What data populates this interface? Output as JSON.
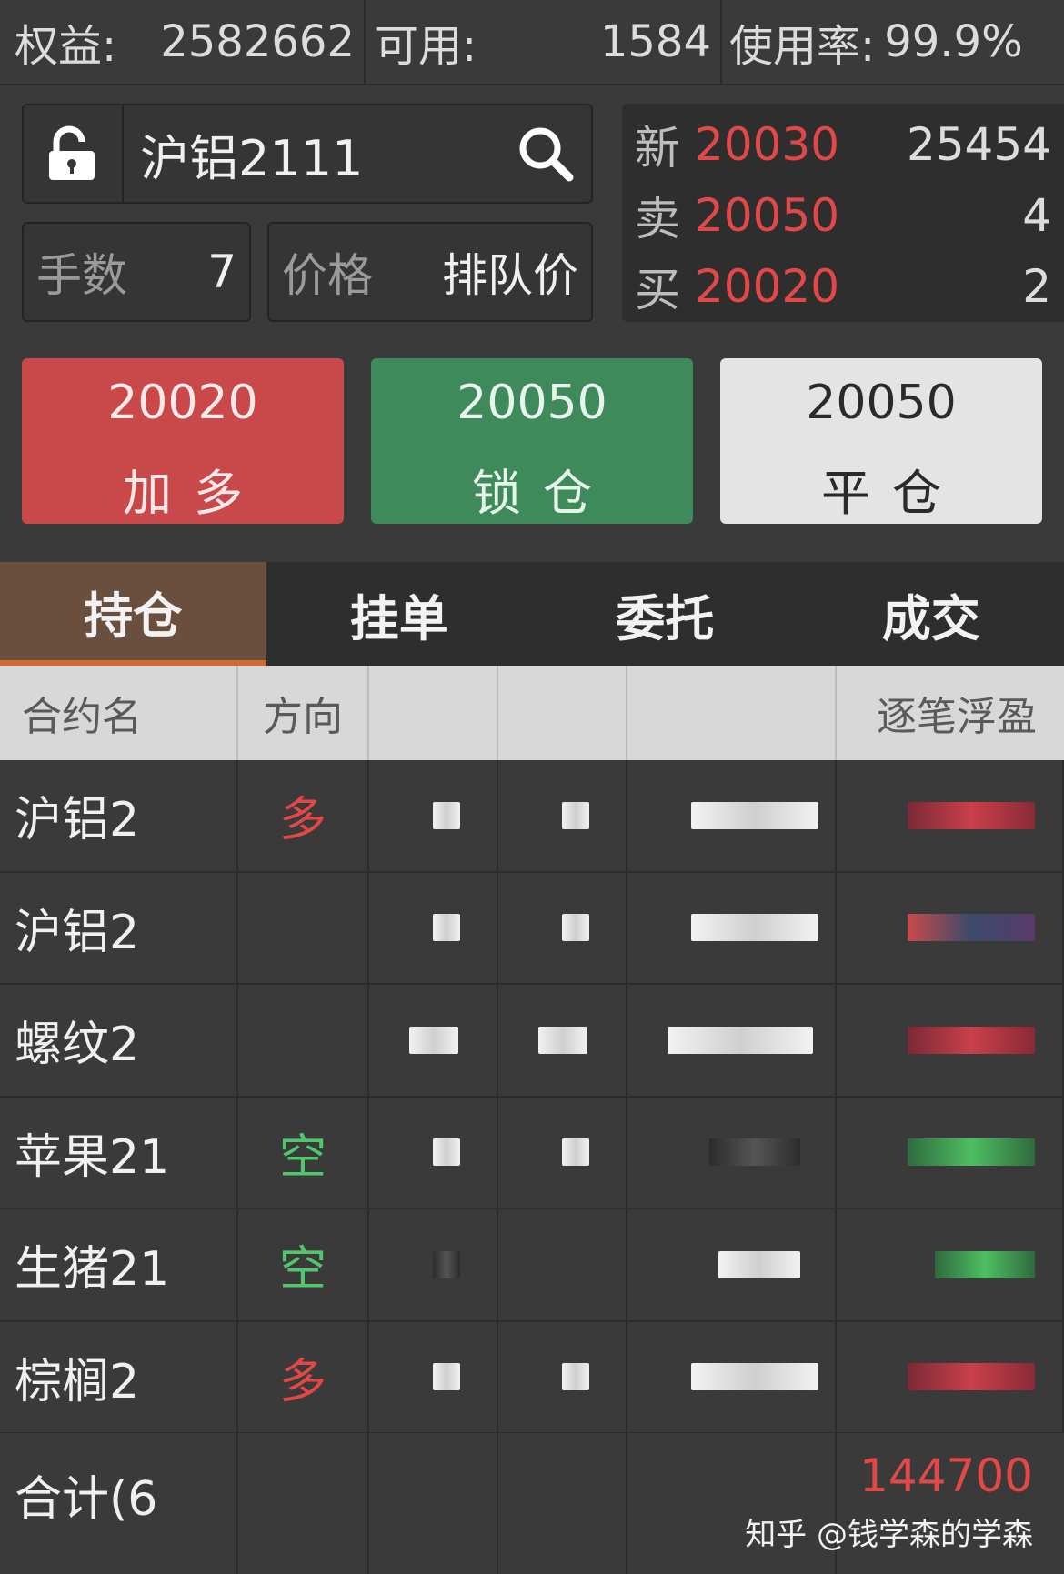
{
  "account": {
    "equity_label": "权益:",
    "equity_value": "2582662",
    "available_label": "可用:",
    "available_value": "1584",
    "usage_label": "使用率:",
    "usage_value": "99.9%"
  },
  "order": {
    "symbol": "沪铝2111",
    "lots_label": "手数",
    "lots_value": "7",
    "price_label": "价格",
    "price_value": "排队价"
  },
  "quote": {
    "last_label": "新",
    "last_price": "20030",
    "last_volume": "25454",
    "ask_label": "卖",
    "ask_price": "20050",
    "ask_volume": "4",
    "bid_label": "买",
    "bid_price": "20020",
    "bid_volume": "2"
  },
  "actions": {
    "buy_price": "20020",
    "buy_label": "加多",
    "lock_price": "20050",
    "lock_label": "锁仓",
    "close_price": "20050",
    "close_label": "平仓"
  },
  "tabs": [
    "持仓",
    "挂单",
    "委托",
    "成交"
  ],
  "table": {
    "headers": {
      "name": "合约名",
      "direction": "方向",
      "pnl": "逐笔浮盈"
    },
    "rows": [
      {
        "name": "沪铝2",
        "direction": "多",
        "dir_class": "long",
        "pnl_class": "red"
      },
      {
        "name": "沪铝2",
        "direction": "",
        "dir_class": "long",
        "pnl_class": "mix"
      },
      {
        "name": "螺纹2",
        "direction": "",
        "dir_class": "long",
        "pnl_class": "red"
      },
      {
        "name": "苹果21",
        "direction": "空",
        "dir_class": "short",
        "pnl_class": "green"
      },
      {
        "name": "生猪21",
        "direction": "空",
        "dir_class": "short",
        "pnl_class": "green"
      },
      {
        "name": "棕榈2",
        "direction": "多",
        "dir_class": "long",
        "pnl_class": "red"
      }
    ],
    "total_label": "合计(6",
    "total_value": "144700"
  },
  "watermark": "知乎 @钱学森的学森",
  "colors": {
    "red": "#e24848",
    "green": "#4ec86a",
    "buy": "#c9484a",
    "lock": "#3e8a5a",
    "tab_active": "#6b4f3e"
  }
}
